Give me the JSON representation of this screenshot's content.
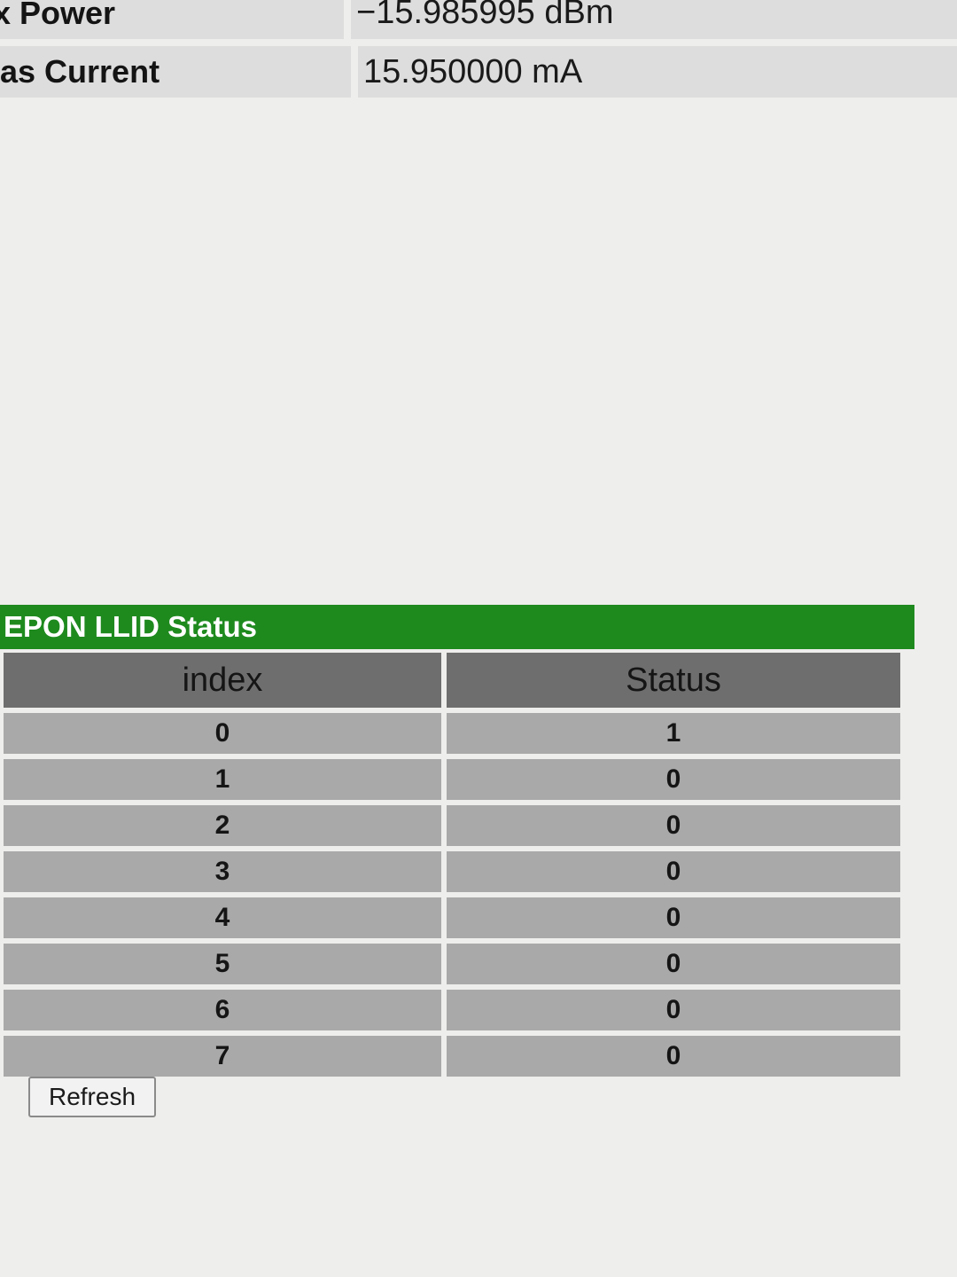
{
  "info": {
    "rows": [
      {
        "label": "x Power",
        "value": "−15.985995 dBm"
      },
      {
        "label": "as Current",
        "value": "15.950000 mA"
      }
    ]
  },
  "llid": {
    "title": "EPON LLID Status",
    "columns": [
      "index",
      "Status"
    ],
    "rows": [
      {
        "index": "0",
        "status": "1"
      },
      {
        "index": "1",
        "status": "0"
      },
      {
        "index": "2",
        "status": "0"
      },
      {
        "index": "3",
        "status": "0"
      },
      {
        "index": "4",
        "status": "0"
      },
      {
        "index": "5",
        "status": "0"
      },
      {
        "index": "6",
        "status": "0"
      },
      {
        "index": "7",
        "status": "0"
      }
    ]
  },
  "actions": {
    "refresh_label": "Refresh"
  },
  "colors": {
    "header_green": "#1e8a1e",
    "column_header_gray": "#6e6e6e",
    "cell_gray": "#a9a9a9",
    "info_cell_gray": "#dddddd"
  }
}
